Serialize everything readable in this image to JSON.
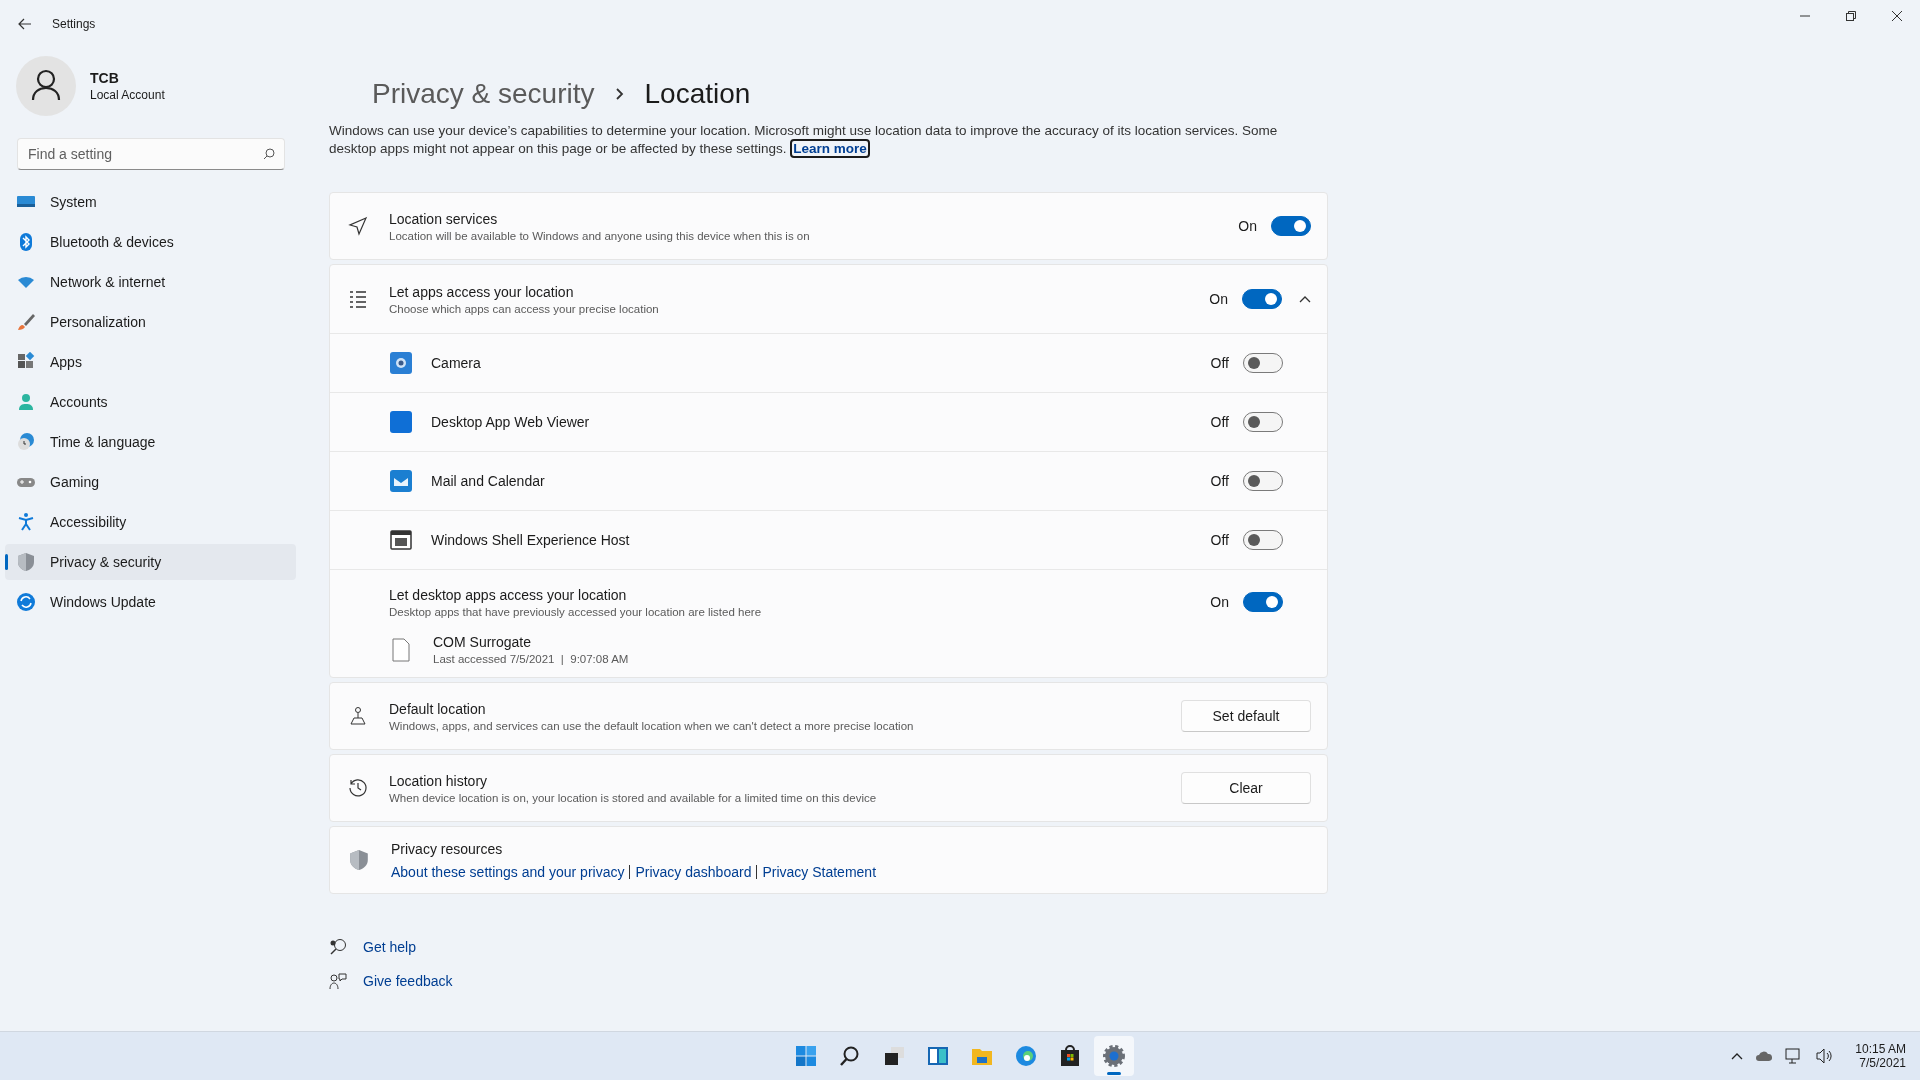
{
  "window": {
    "title": "Settings"
  },
  "profile": {
    "name": "TCB",
    "account": "Local Account"
  },
  "search": {
    "placeholder": "Find a setting"
  },
  "nav": [
    {
      "label": "System",
      "kind": "system",
      "selected": false
    },
    {
      "label": "Bluetooth & devices",
      "kind": "bluetooth",
      "selected": false
    },
    {
      "label": "Network & internet",
      "kind": "network",
      "selected": false
    },
    {
      "label": "Personalization",
      "kind": "brush",
      "selected": false
    },
    {
      "label": "Apps",
      "kind": "apps",
      "selected": false
    },
    {
      "label": "Accounts",
      "kind": "accounts",
      "selected": false
    },
    {
      "label": "Time & language",
      "kind": "time",
      "selected": false
    },
    {
      "label": "Gaming",
      "kind": "gaming",
      "selected": false
    },
    {
      "label": "Accessibility",
      "kind": "accessibility",
      "selected": false
    },
    {
      "label": "Privacy & security",
      "kind": "privacy",
      "selected": true
    },
    {
      "label": "Windows Update",
      "kind": "update",
      "selected": false
    }
  ],
  "breadcrumb": {
    "parent": "Privacy & security",
    "current": "Location"
  },
  "description": {
    "text": "Windows can use your device’s capabilities to determine your location. Microsoft might use location data to improve the accuracy of its location services. Some desktop apps might not appear on this page or be affected by these settings.",
    "link": "Learn more"
  },
  "location_services": {
    "title": "Location services",
    "subtitle": "Location will be available to Windows and anyone using this device when this is on",
    "state_label": "On",
    "on": true
  },
  "app_access": {
    "title": "Let apps access your location",
    "subtitle": "Choose which apps can access your precise location",
    "state_label": "On",
    "on": true,
    "expanded": true,
    "apps": [
      {
        "name": "Camera",
        "kind": "camera",
        "state_label": "Off",
        "on": false
      },
      {
        "name": "Desktop App Web Viewer",
        "kind": "viewer",
        "state_label": "Off",
        "on": false
      },
      {
        "name": "Mail and Calendar",
        "kind": "mail",
        "state_label": "Off",
        "on": false
      },
      {
        "name": "Windows Shell Experience Host",
        "kind": "shell",
        "state_label": "Off",
        "on": false
      }
    ],
    "desktop": {
      "title": "Let desktop apps access your location",
      "subtitle": "Desktop apps that have previously accessed your location are listed here",
      "state_label": "On",
      "on": true,
      "apps": [
        {
          "name": "COM Surrogate",
          "detail": "Last accessed 7/5/2021  |  9:07:08 AM"
        }
      ]
    }
  },
  "default_location": {
    "title": "Default location",
    "subtitle": "Windows, apps, and services can use the default location when we can't detect a more precise location",
    "button": "Set default"
  },
  "location_history": {
    "title": "Location history",
    "subtitle": "When device location is on, your location is stored and available for a limited time on this device",
    "button": "Clear"
  },
  "privacy_resources": {
    "title": "Privacy resources",
    "links": [
      "About these settings and your privacy",
      "Privacy dashboard",
      "Privacy Statement"
    ]
  },
  "help_links": [
    {
      "label": "Get help",
      "kind": "help"
    },
    {
      "label": "Give feedback",
      "kind": "feedback"
    }
  ],
  "taskbar": {
    "apps": [
      {
        "kind": "start",
        "selected": false
      },
      {
        "kind": "search",
        "selected": false
      },
      {
        "kind": "taskview",
        "selected": false
      },
      {
        "kind": "widgets",
        "selected": false
      },
      {
        "kind": "explorer",
        "selected": false
      },
      {
        "kind": "edge",
        "selected": false
      },
      {
        "kind": "store",
        "selected": false
      },
      {
        "kind": "settings",
        "selected": true
      }
    ],
    "time": "10:15 AM",
    "date": "7/5/2021"
  }
}
